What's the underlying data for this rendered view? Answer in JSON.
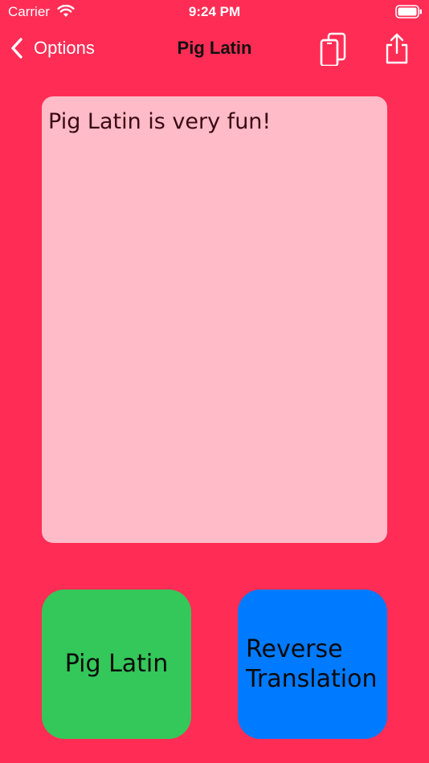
{
  "status_bar": {
    "carrier": "Carrier",
    "time": "9:24 PM"
  },
  "nav": {
    "back_label": "Options",
    "title": "Pig Latin"
  },
  "editor": {
    "text": "Pig Latin is very fun!"
  },
  "buttons": {
    "pig_latin_label": "Pig Latin",
    "reverse_line1": "Reverse",
    "reverse_line2": "Translation"
  },
  "colors": {
    "background": "#FF2D55",
    "text_area": "#FFBBC8",
    "pig_latin_button": "#34C759",
    "reverse_button": "#007AFF"
  },
  "icons": {
    "wifi": "wifi-icon",
    "battery": "battery-icon",
    "back": "chevron-left-icon",
    "copy": "copy-icon",
    "share": "share-icon"
  }
}
